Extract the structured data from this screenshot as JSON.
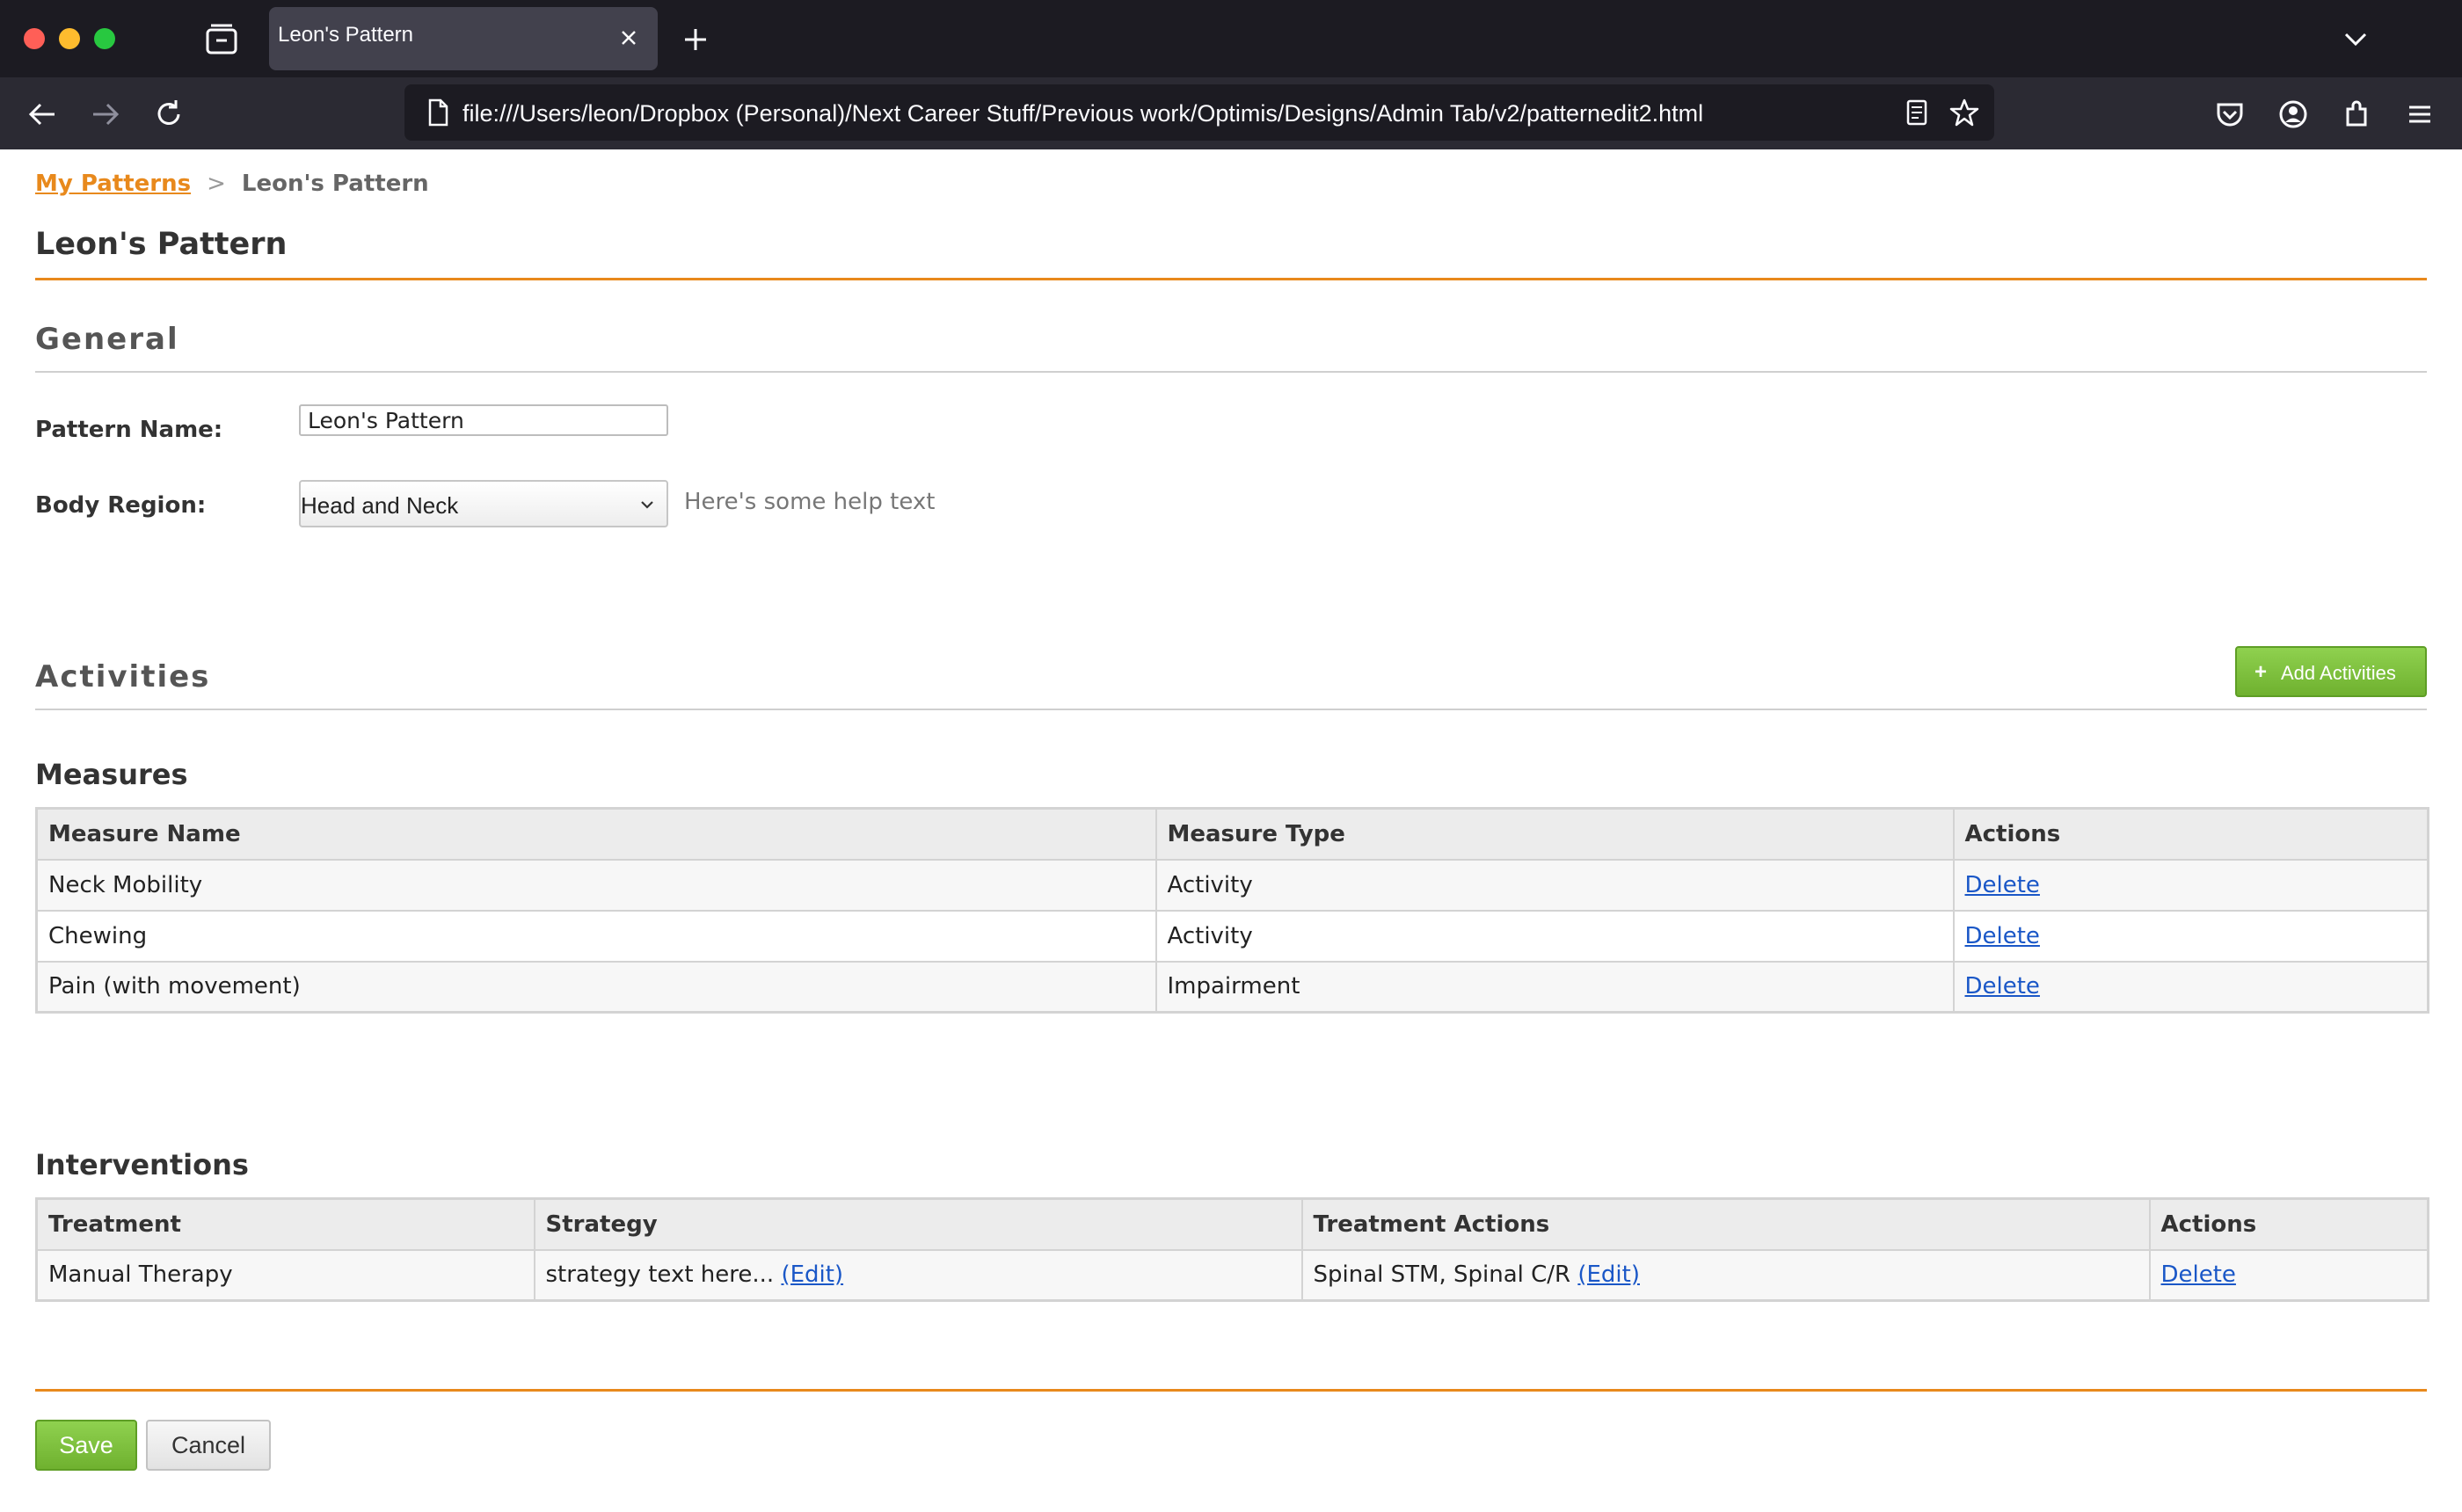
{
  "browser": {
    "tab_title": "Leon's Pattern",
    "url": "file:///Users/leon/Dropbox (Personal)/Next Career Stuff/Previous work/Optimis/Designs/Admin Tab/v2/patternedit2.html"
  },
  "breadcrumb": {
    "parent": "My Patterns",
    "separator": ">",
    "current": "Leon's Pattern"
  },
  "page_title": "Leon's Pattern",
  "general": {
    "section_title": "General",
    "pattern_name_label": "Pattern Name:",
    "pattern_name_value": "Leon's Pattern",
    "body_region_label": "Body Region:",
    "body_region_value": "Head and Neck",
    "help_text": "Here's some help text"
  },
  "activities": {
    "section_title": "Activities",
    "add_button_icon": "+",
    "add_button_label": "Add Activities"
  },
  "measures": {
    "title": "Measures",
    "columns": [
      "Measure Name",
      "Measure Type",
      "Actions"
    ],
    "rows": [
      {
        "name": "Neck Mobility",
        "type": "Activity",
        "action": "Delete"
      },
      {
        "name": "Chewing",
        "type": "Activity",
        "action": "Delete"
      },
      {
        "name": "Pain (with movement)",
        "type": "Impairment",
        "action": "Delete"
      }
    ]
  },
  "interventions": {
    "title": "Interventions",
    "columns": [
      "Treatment",
      "Strategy",
      "Treatment Actions",
      "Actions"
    ],
    "rows": [
      {
        "treatment": "Manual Therapy",
        "strategy": "strategy text here...",
        "strategy_edit": "(Edit)",
        "treatment_actions": "Spinal STM, Spinal C/R",
        "treatment_actions_edit": "(Edit)",
        "action": "Delete"
      }
    ]
  },
  "footer": {
    "save_label": "Save",
    "cancel_label": "Cancel"
  },
  "colors": {
    "accent_orange": "#e8891c",
    "button_green": "#7cbf3c",
    "link_blue": "#1a57c7"
  }
}
